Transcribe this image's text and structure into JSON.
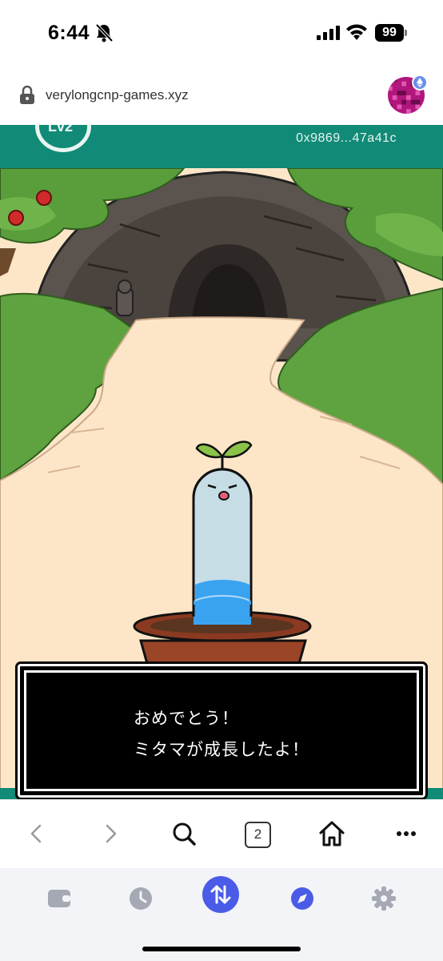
{
  "status_bar": {
    "time": "6:44",
    "battery": "99",
    "icons": [
      "bell-slash-icon",
      "cellular-signal-icon",
      "wifi-icon",
      "battery-icon"
    ]
  },
  "url_bar": {
    "url": "verylongcnp-games.xyz",
    "icons": [
      "lock-icon",
      "wallet-avatar",
      "ethereum-badge-icon"
    ]
  },
  "game": {
    "level": "Lv2",
    "wallet_address": "0x9869...47a41c",
    "dialog": {
      "line1": "おめでとう！",
      "line2": "ミタマが成長したよ！"
    },
    "colors": {
      "header": "#118a77",
      "path": "#fde6c8",
      "grass": "#5a9e3c"
    }
  },
  "browser_toolbar": {
    "tab_count": "2",
    "icons": [
      "back-chevron-icon",
      "forward-chevron-icon",
      "search-icon",
      "tabs-icon",
      "home-icon",
      "more-icon"
    ]
  },
  "app_nav": {
    "icons": [
      "wallet-icon",
      "clock-icon",
      "swap-icon",
      "compass-icon",
      "gear-icon"
    ],
    "accent": "#4a5be8"
  }
}
